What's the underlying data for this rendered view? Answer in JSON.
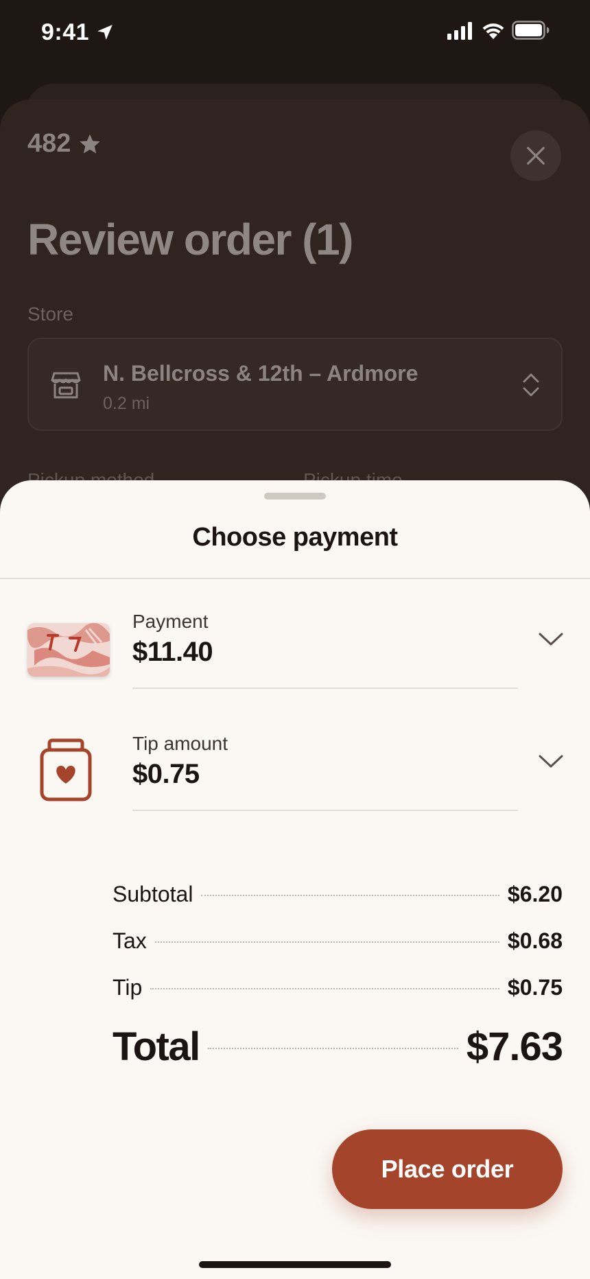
{
  "status_bar": {
    "time": "9:41",
    "icons": [
      "location-arrow-icon",
      "signal-icon",
      "wifi-icon",
      "battery-icon"
    ]
  },
  "background_screen": {
    "rating": "482",
    "rating_icon": "star-icon",
    "title": "Review order (1)",
    "store_label": "Store",
    "store": {
      "name": "N. Bellcross & 12th – Ardmore",
      "distance": "0.2 mi",
      "icon": "storefront-icon"
    },
    "pickup_method_label": "Pickup method",
    "pickup_time_label": "Pickup time"
  },
  "payment_sheet": {
    "title": "Choose payment",
    "payment": {
      "label": "Payment",
      "value": "$11.40",
      "icon": "gift-card-thumbnail"
    },
    "tip": {
      "label": "Tip amount",
      "value": "$0.75",
      "icon": "tip-jar-icon"
    },
    "summary": {
      "subtotal_label": "Subtotal",
      "subtotal_value": "$6.20",
      "tax_label": "Tax",
      "tax_value": "$0.68",
      "tip_label": "Tip",
      "tip_value": "$0.75",
      "total_label": "Total",
      "total_value": "$7.63"
    },
    "place_order_label": "Place order"
  },
  "colors": {
    "accent": "#a4442a",
    "sheet_background": "#fbf8f4",
    "backdrop": "#1f1714"
  }
}
